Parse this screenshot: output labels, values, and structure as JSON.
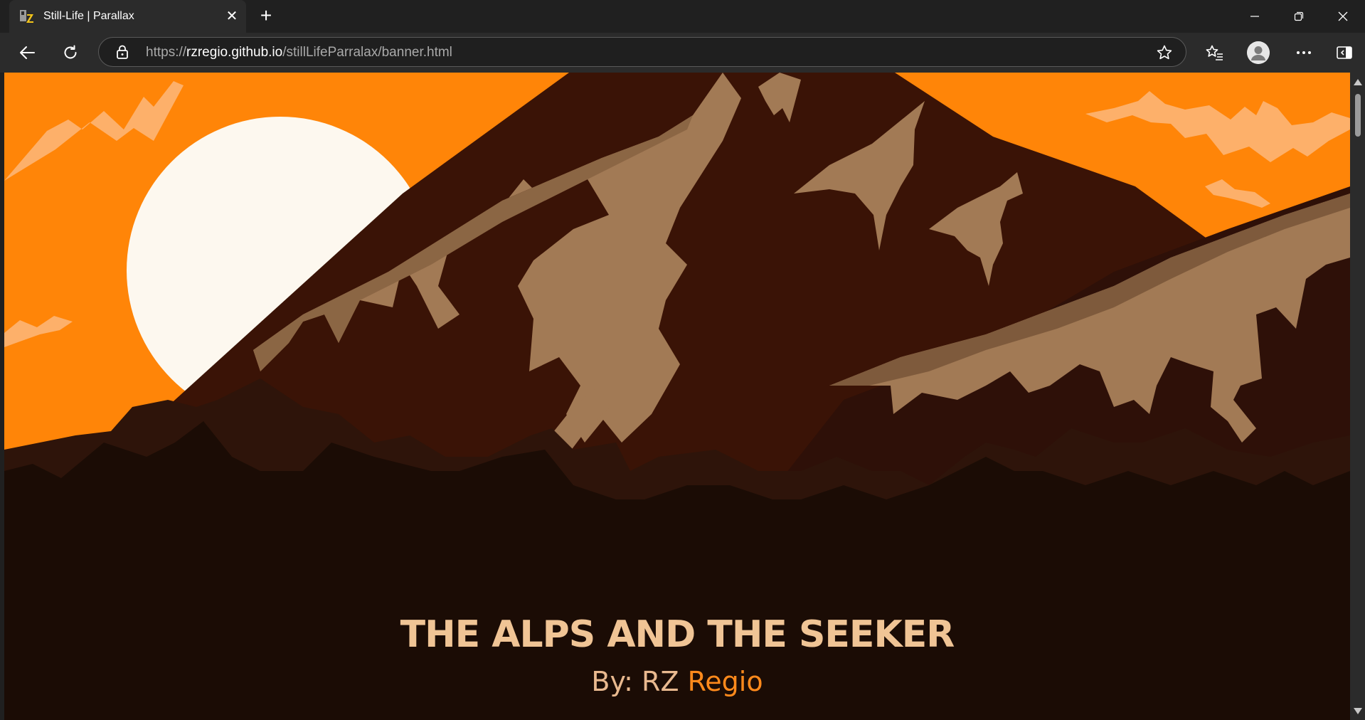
{
  "browser": {
    "tab": {
      "title": "Still-Life | Parallax",
      "close_glyph": "✕"
    },
    "new_tab_glyph": "+",
    "address": {
      "scheme": "https://",
      "host": "rzregio.github.io",
      "path": "/stillLifeParralax/banner.html"
    },
    "icons": [
      "back-icon",
      "refresh-icon",
      "lock-icon",
      "star-icon",
      "favorites-icon",
      "profile-icon",
      "more-icon",
      "sidebar-icon",
      "minimize-icon",
      "restore-icon",
      "close-icon"
    ]
  },
  "page": {
    "title": "THE ALPS AND THE SEEKER",
    "by_prefix": "By: RZ",
    "by_accent": "Regio",
    "colors": {
      "sky": "#ff8508",
      "sun": "#fdf8ef",
      "mountain_dark": "#3a1306",
      "snow": "#a27a55",
      "foreground": "#1b0c05",
      "title": "#f0c495",
      "accent": "#ff8a1c"
    }
  }
}
